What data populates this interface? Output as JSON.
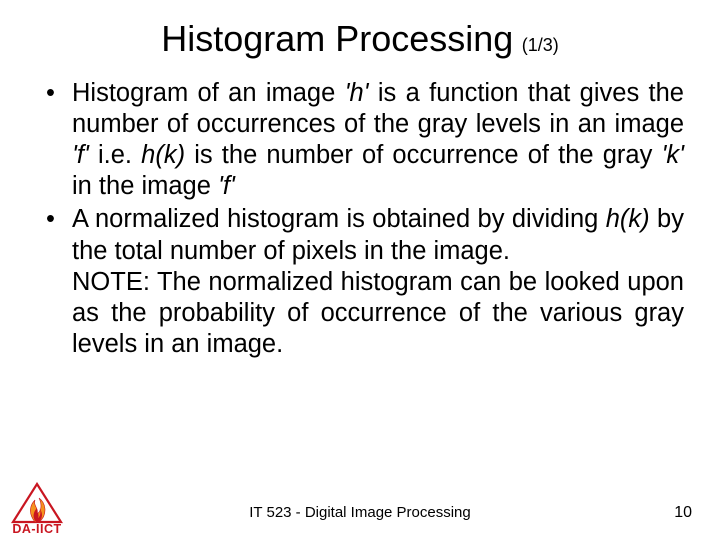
{
  "title": "Histogram Processing",
  "title_suffix": "(1/3)",
  "bullets": [
    {
      "html": "Histogram of an image <em class='var'>'h'</em> is a function that gives the number of occurrences of the gray levels in an image <em class='var'>'f'</em> i.e. <em class='var'>h(k)</em> is the number of occurrence of the gray <em class='var'>'k'</em> in the image <em class='var'>'f'</em>"
    },
    {
      "html": "A normalized histogram is obtained by dividing <em class='var'>h(k)</em> by the total number of pixels in the image.<span class='note'>NOTE: The normalized histogram can be looked upon as the probability of occurrence of the various gray levels in an image.</span>"
    }
  ],
  "footer": {
    "center": "IT 523 - Digital Image Processing",
    "page": "10"
  },
  "logo": {
    "text": "DA-IICT"
  }
}
